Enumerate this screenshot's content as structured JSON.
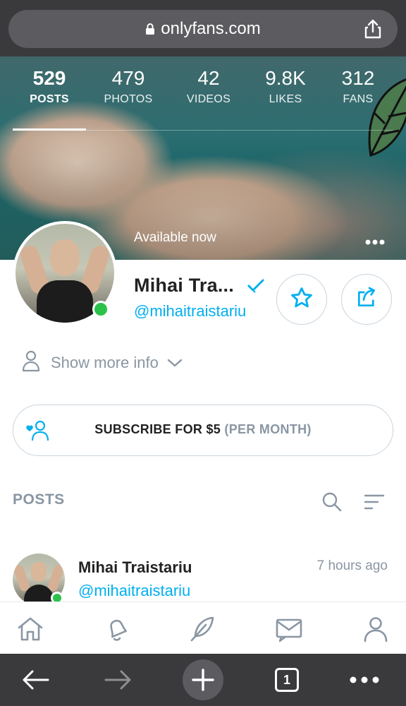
{
  "browser": {
    "url": "onlyfans.com",
    "lock_icon": "lock-icon",
    "share_icon": "share-icon",
    "bottom": {
      "back_icon": "arrow-left-icon",
      "forward_icon": "arrow-right-icon",
      "new_tab_icon": "plus-icon",
      "tab_count": "1",
      "menu_icon": "more-horizontal-icon"
    }
  },
  "stats": [
    {
      "value": "529",
      "label": "POSTS",
      "active": true
    },
    {
      "value": "479",
      "label": "PHOTOS",
      "active": false
    },
    {
      "value": "42",
      "label": "VIDEOS",
      "active": false
    },
    {
      "value": "9.8K",
      "label": "LIKES",
      "active": false
    },
    {
      "value": "312",
      "label": "FANS",
      "active": false
    }
  ],
  "profile": {
    "status": "Available now",
    "name": "Mihai Tra...",
    "handle": "@mihaitraistariu",
    "online": true,
    "show_more_info": "Show more info"
  },
  "subscribe": {
    "main": "SUBSCRIBE FOR $5",
    "period": "(PER MONTH)"
  },
  "posts": {
    "header": "POSTS",
    "items": [
      {
        "name": "Mihai Traistariu",
        "handle": "@mihaitraistariu",
        "time": "7 hours ago"
      }
    ]
  },
  "nav": [
    "home-icon",
    "bell-icon",
    "feather-icon",
    "mail-icon",
    "user-icon"
  ],
  "colors": {
    "accent": "#00aff0",
    "muted": "#8a96a3",
    "online": "#2bc24a",
    "browser_chrome": "#3a3a3c"
  }
}
